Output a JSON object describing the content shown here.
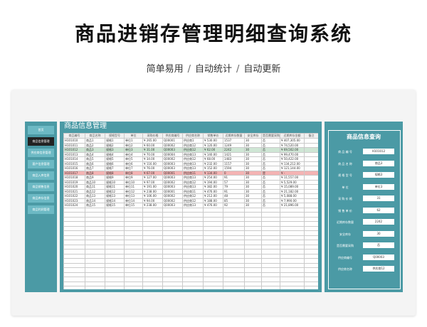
{
  "header": {
    "title": "商品进销存管理明细查询系统",
    "subtitle_items": [
      "简单易用",
      "自动统计",
      "自动更新"
    ],
    "separator": "/"
  },
  "sidebar": {
    "items": [
      {
        "label": "首页",
        "active": false
      },
      {
        "label": "商品信息管理",
        "active": true
      },
      {
        "label": "供应商信息管理",
        "active": false
      },
      {
        "label": "客户信息管理",
        "active": false
      },
      {
        "label": "商品入库信息",
        "active": false
      },
      {
        "label": "商品销售信息",
        "active": false
      },
      {
        "label": "商品库存信息",
        "active": false
      },
      {
        "label": "商品利润管理",
        "active": false
      }
    ]
  },
  "main": {
    "title": "商品信息管理",
    "columns": [
      "商品编号",
      "商品名称",
      "规格型号",
      "单位",
      "采购价格",
      "供应商编号",
      "供应商名称",
      "销售单价",
      "近期库存数量",
      "安全库存",
      "是否需要采购",
      "近期库存金额",
      "备注"
    ],
    "rows": [
      [
        "H101010",
        "商品1",
        "规格1",
        "单位1",
        "¥  265.00",
        "Q00001",
        "供应商1",
        "¥  530.00",
        "1537",
        "30",
        "否",
        "¥  407,305.00",
        ""
      ],
      [
        "H101011",
        "商品2",
        "规格2",
        "单位2",
        "¥   60.00",
        "Q00002",
        "供应商12",
        "¥  120.00",
        "1249",
        "30",
        "否",
        "¥   74,520.00",
        ""
      ],
      [
        "H101012",
        "商品3",
        "规格3",
        "单位3",
        "¥   31.00",
        "Q00003",
        "供应商12",
        "¥   62.00",
        "2242",
        "30",
        "否",
        "¥   69,502.00",
        ""
      ],
      [
        "H101013",
        "商品4",
        "规格4",
        "单位4",
        "¥   70.00",
        "Q00004",
        "供应商13",
        "¥  140.00",
        "1421",
        "30",
        "否",
        "¥   99,470.00",
        ""
      ],
      [
        "H101014",
        "商品5",
        "规格5",
        "单位5",
        "¥   34.00",
        "Q00002",
        "供应商12",
        "¥   68.00",
        "1483",
        "30",
        "否",
        "¥   50,422.00",
        ""
      ],
      [
        "H101015",
        "商品6",
        "规格6",
        "单位6",
        "¥  116.00",
        "Q00003",
        "供应商13",
        "¥  232.00",
        "1157",
        "30",
        "否",
        "¥  134,212.00",
        ""
      ],
      [
        "H101016",
        "商品7",
        "规格7",
        "单位7",
        "¥   76.00",
        "Q00003",
        "供应商13",
        "¥  152.00",
        "1594",
        "30",
        "否",
        "¥  121,144.00",
        ""
      ],
      [
        "H101017",
        "商品8",
        "规格8",
        "单位8",
        "¥   67.00",
        "Q00001",
        "供应商11",
        "¥  134.00",
        "0",
        "30",
        "是",
        "¥          -",
        ""
      ],
      [
        "H101018",
        "商品9",
        "规格9",
        "单位9",
        "¥  127.00",
        "Q00003",
        "供应商13",
        "¥  254.00",
        "91",
        "30",
        "否",
        "¥   11,557.00",
        ""
      ],
      [
        "H101019",
        "商品10",
        "规格10",
        "单位10",
        "¥   97.00",
        "Q00002",
        "供应商12",
        "¥  194.00",
        "57",
        "30",
        "否",
        "¥    5,529.00",
        ""
      ],
      [
        "H101020",
        "商品11",
        "规格11",
        "单位11",
        "¥  191.00",
        "Q00003",
        "供应商13",
        "¥  382.00",
        "79",
        "30",
        "否",
        "¥   15,089.00",
        ""
      ],
      [
        "H101021",
        "商品12",
        "规格12",
        "单位12",
        "¥  238.00",
        "Q00001",
        "供应商11",
        "¥  476.00",
        "91",
        "30",
        "否",
        "¥   21,182.00",
        ""
      ],
      [
        "H101022",
        "商品13",
        "规格13",
        "单位13",
        "¥  106.00",
        "Q00002",
        "供应商12",
        "¥  212.00",
        "48",
        "30",
        "否",
        "¥    5,088.00",
        ""
      ],
      [
        "H101023",
        "商品14",
        "规格14",
        "单位14",
        "¥   94.00",
        "Q00002",
        "供应商12",
        "¥  188.00",
        "85",
        "30",
        "否",
        "¥    7,990.00",
        ""
      ],
      [
        "H101024",
        "商品15",
        "规格15",
        "单位15",
        "¥  238.00",
        "Q00003",
        "供应商13",
        "¥  476.00",
        "92",
        "30",
        "否",
        "¥   21,896.00",
        ""
      ]
    ],
    "empty_rows": 23,
    "highlight": {
      "green_row": 2,
      "red_row": 7
    }
  },
  "query": {
    "title": "商品信息查询",
    "fields": [
      {
        "label": "商 品 编 号",
        "value": "H101012"
      },
      {
        "label": "商 品 名 称",
        "value": "商品3"
      },
      {
        "label": "规 格 型 号",
        "value": "规格3"
      },
      {
        "label": "单       位",
        "value": "单位3"
      },
      {
        "label": "采 购 价 格",
        "value": "31"
      },
      {
        "label": "销 售 单 价",
        "value": "62"
      },
      {
        "label": "近期库存数量",
        "value": "2242"
      },
      {
        "label": "安全库存",
        "value": "30"
      },
      {
        "label": "是否需要采购",
        "value": "否"
      },
      {
        "label": "供应商编号",
        "value": "Q00003"
      },
      {
        "label": "供应商名称",
        "value": "供应商12"
      }
    ]
  },
  "colors": {
    "teal": "#4b9aa5",
    "light_teal": "#6cb9c4",
    "green_row": "#cfe6d5",
    "red_row": "#f3b3b3"
  }
}
